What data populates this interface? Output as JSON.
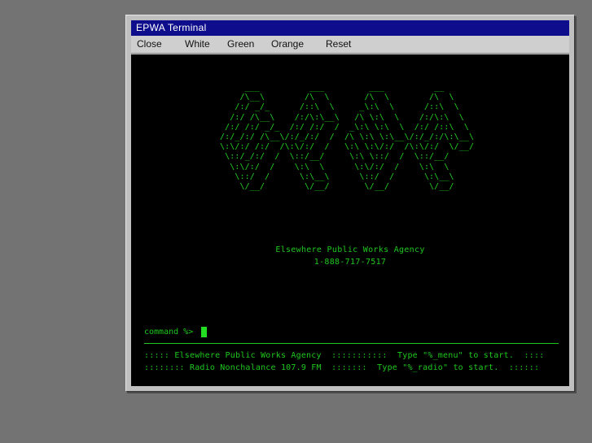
{
  "window": {
    "title": "EPWA Terminal"
  },
  "menu": [
    {
      "label": "Close"
    },
    {
      "label": "White"
    },
    {
      "label": "Green"
    },
    {
      "label": "Orange"
    },
    {
      "label": "Reset"
    }
  ],
  "terminal": {
    "ascii_logo": "     ___          ___         ___          __\n    /\\__\\        /\\  \\       /\\  \\        /\\  \\\n   /:/ _/_      /::\\  \\     _\\:\\  \\      /::\\  \\\n  /:/ /\\__\\    /:/\\:\\__\\   /\\ \\:\\  \\    /:/\\:\\  \\\n /:/ /:/ _/_  /:/ /:/  /  _\\:\\ \\:\\  \\  /:/ /::\\  \\\n/:/_/:/ /\\__\\/:/_/:/  /  /\\ \\:\\ \\:\\__\\/:/_/:/\\:\\__\\\n\\:\\/:/ /:/  /\\:\\/:/  /   \\:\\ \\:\\/:/  /\\:\\/:/  \\/__/\n \\::/_/:/  /  \\::/__/     \\:\\ \\::/  /  \\::/__/\n  \\:\\/:/  /    \\:\\  \\      \\:\\/:/  /    \\:\\  \\\n   \\::/  /      \\:\\__\\      \\::/  /      \\:\\__\\\n    \\/__/        \\/__/       \\/__/        \\/__/",
    "agency_name": "Elsewhere Public Works Agency",
    "phone": "1-888-717-7517",
    "prompt": "command %>",
    "status_line_1": "::::: Elsewhere Public Works Agency  :::::::::::  Type \"%_menu\" to start.  ::::",
    "status_line_2": ":::::::: Radio Nonchalance 107.9 FM  :::::::  Type \"%_radio\" to start.  ::::::"
  },
  "colors": {
    "desktop": "#737373",
    "titlebar": "#0e0e8c",
    "terminal_bg": "#000000",
    "terminal_text": "#1ec81e"
  }
}
